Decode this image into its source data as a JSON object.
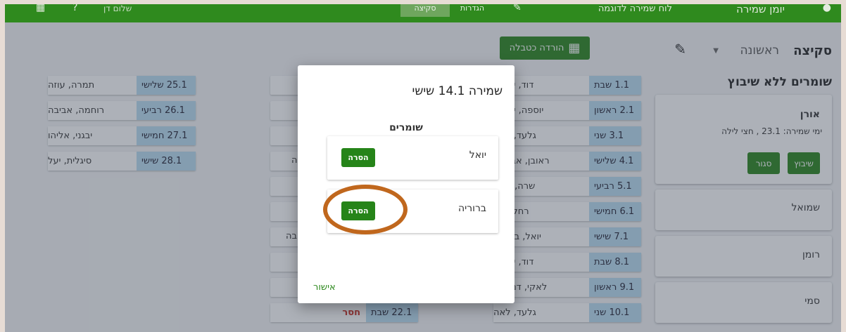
{
  "topbar": {
    "app_name": "יומן שמירה",
    "subtitle": "לוח שמירה לדוגמה",
    "tab_sketch": "סקיצה",
    "tab_final": "הגדרות",
    "user": "שלום דן"
  },
  "header": {
    "title": "סקיצה",
    "round": "ראשונה",
    "download_label": "הורדה כטבלה"
  },
  "unassigned": {
    "title": "שומרים ללא שיבוץ",
    "cards": [
      {
        "name": "אורן",
        "days": "ימי שמירה: 23.1 , חצי לילה",
        "assign_label": "שיבוץ",
        "close_label": "סגור"
      },
      {
        "name": "שמואל"
      },
      {
        "name": "רומן"
      },
      {
        "name": "סמי"
      }
    ]
  },
  "col_a": [
    {
      "date": "1.1 שבת",
      "names": "דוד, יעקוב"
    },
    {
      "date": "2.1 ראשון",
      "names": "יוספה, יוספה"
    },
    {
      "date": "3.1 שני",
      "names": "גלעד, לאה"
    },
    {
      "date": "4.1 שלישי",
      "names": "ראובן, אברהם"
    },
    {
      "date": "5.1 רביעי",
      "names": "שרה, מיכל"
    },
    {
      "date": "6.1 חמישי",
      "names": "רחל, אבי"
    },
    {
      "date": "7.1 שישי",
      "names": "יואל, ברוריה"
    },
    {
      "date": "8.1 שבת",
      "names": "דוד, יעקוב"
    },
    {
      "date": "9.1 ראשון",
      "names": "לאקי, דניאלה"
    },
    {
      "date": "10.1 שני",
      "names": "גלעד, לאה"
    }
  ],
  "col_b_bottom": {
    "date": "22.1 שבת",
    "status": "חסר"
  },
  "col_b_partial": {
    "row4": "ה",
    "row7": "בה"
  },
  "col_c": [
    {
      "date": "25.1 שלישי",
      "names": "תמרה, עוזה"
    },
    {
      "date": "26.1 רביעי",
      "names": "רוחמה, אביבה"
    },
    {
      "date": "27.1 חמישי",
      "names": "יבגני, אליהו"
    },
    {
      "date": "28.1 שישי",
      "names": "סיגלית, יעל"
    }
  ],
  "dialog": {
    "title": "שמירה 14.1 שישי",
    "section": "שומרים",
    "guards": [
      {
        "name": "יואל",
        "remove_label": "הסרה"
      },
      {
        "name": "ברוריה",
        "remove_label": "הסרה"
      }
    ],
    "confirm_label": "אישור"
  }
}
